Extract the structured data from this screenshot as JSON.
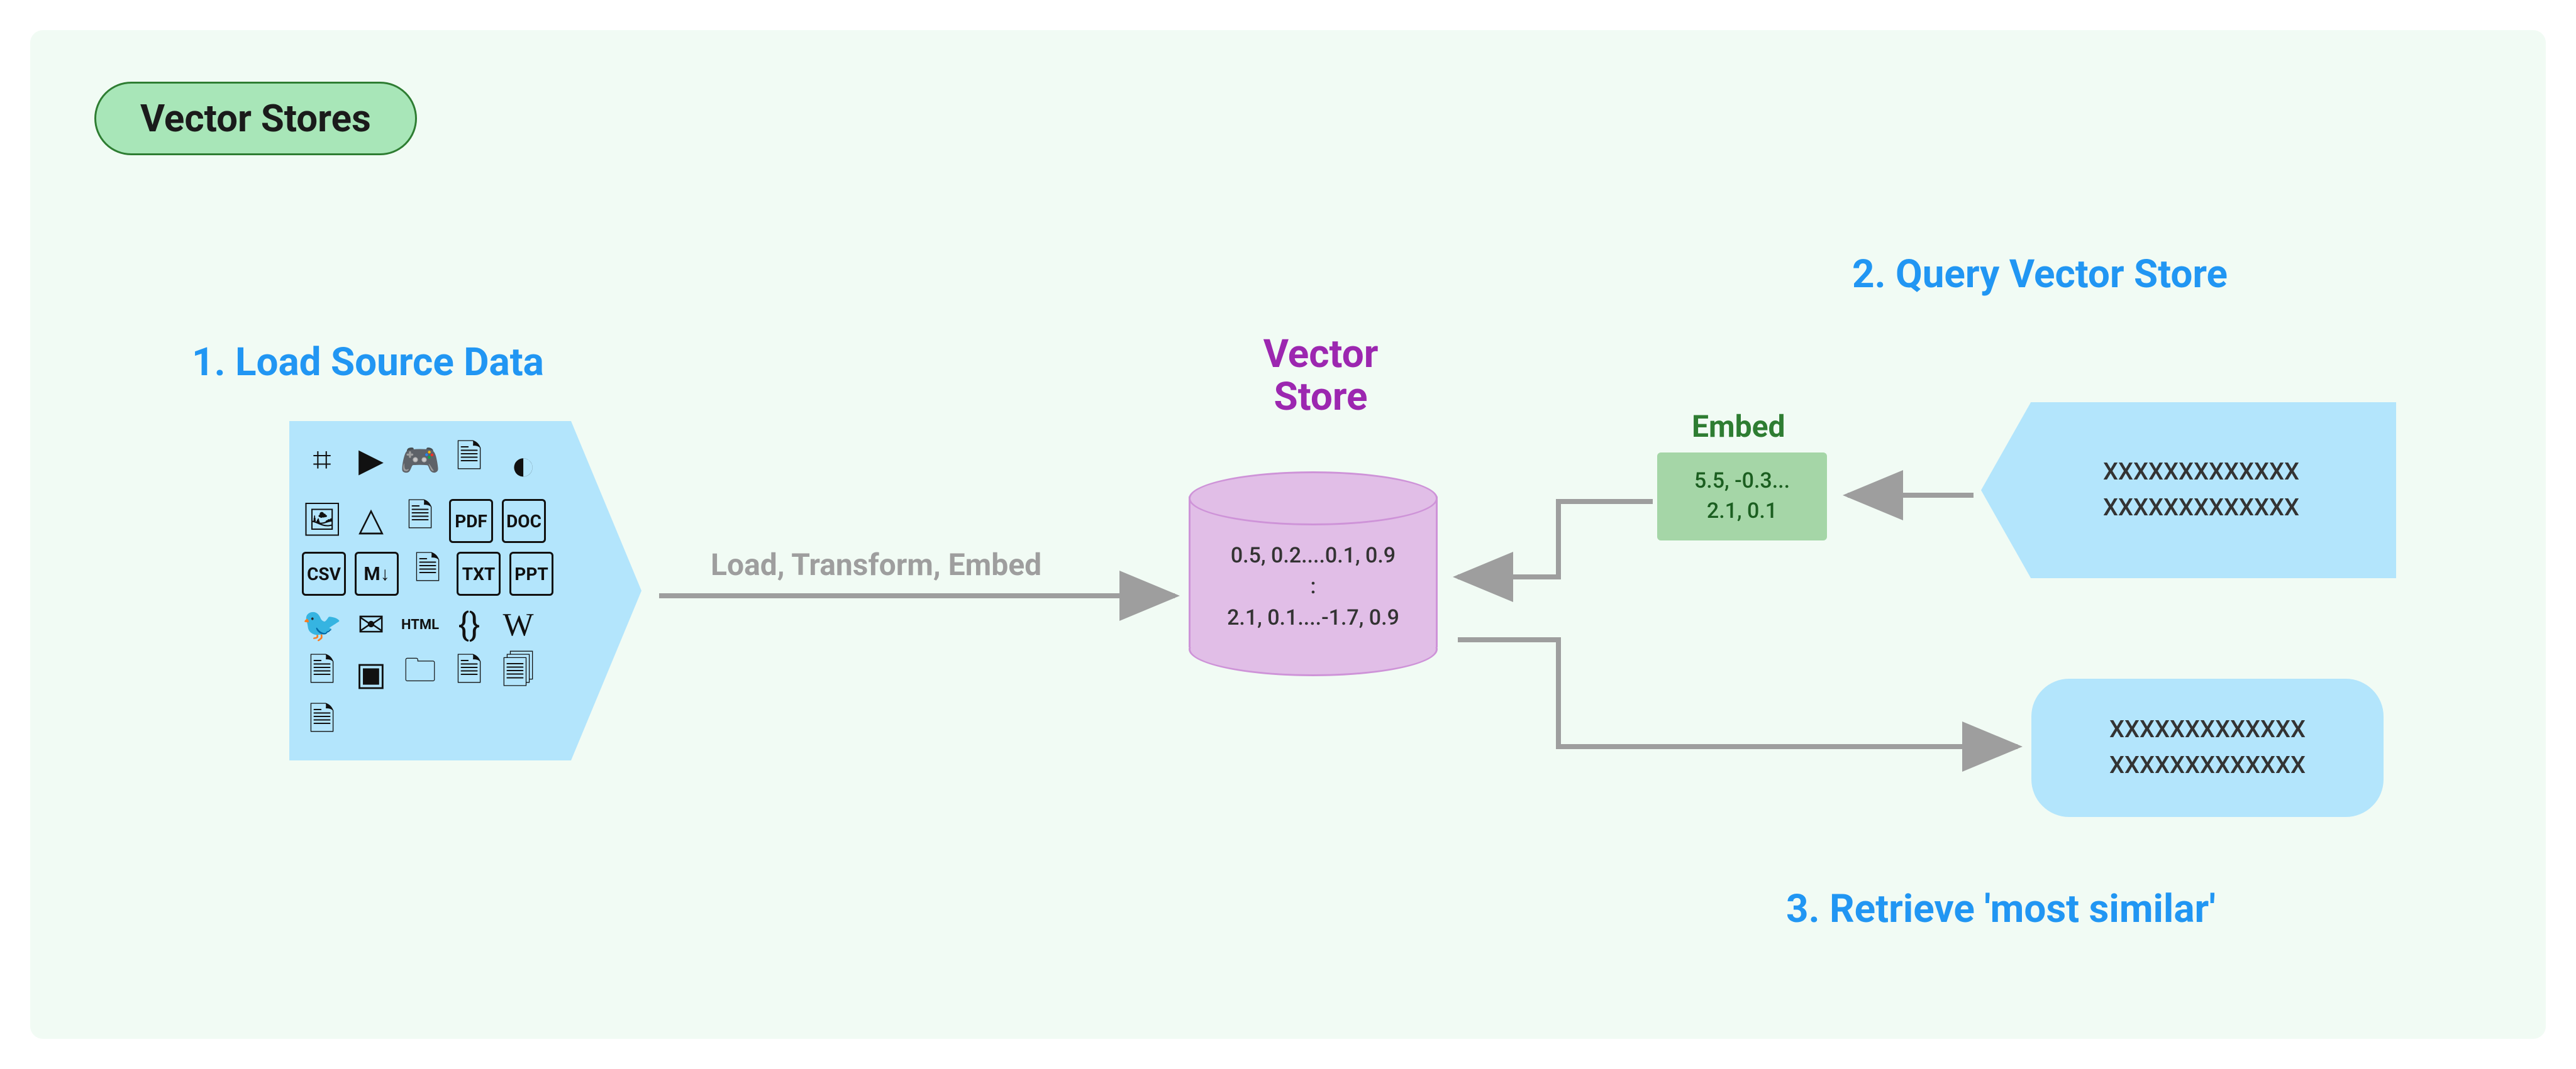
{
  "title": "Vector Stores",
  "steps": {
    "load": "1.  Load Source Data",
    "query": "2.  Query Vector Store",
    "retrieve": "3.  Retrieve 'most similar'"
  },
  "vector_store_label": "Vector\nStore",
  "arrow_label": "Load, Transform, Embed",
  "embed_label": "Embed",
  "cylinder": {
    "row1": "0.5, 0.2....0.1, 0.9",
    "row2": ":",
    "row3": "2.1, 0.1....-1.7, 0.9"
  },
  "embed_box": {
    "line1": "5.5, -0.3...",
    "line2": "2.1, 0.1"
  },
  "query_box": {
    "line1": "XXXXXXXXXXXXX",
    "line2": "XXXXXXXXXXXXX"
  },
  "result_box": {
    "line1": "XXXXXXXXXXXXX",
    "line2": "XXXXXXXXXXXXX"
  },
  "source_icons": [
    "slack-icon",
    "youtube-icon",
    "discord-icon",
    "file-icon",
    "github-icon",
    "image-icon",
    "gdrive-icon",
    "file-icon",
    "pdf-icon",
    "doc-icon",
    "csv-icon",
    "markdown-icon",
    "file-icon",
    "txt-icon",
    "ppt-icon",
    "twitter-icon",
    "mail-icon",
    "html-icon",
    "code-icon",
    "wikipedia-icon",
    "file-icon",
    "css-icon",
    "folder-icon",
    "file-icon",
    "file-icon",
    "file-icon"
  ],
  "colors": {
    "panel_bg": "#f1fbf4",
    "pill_bg": "#a8e6b8",
    "pill_border": "#2e7d32",
    "step_text": "#2196f3",
    "vs_text": "#9c27b0",
    "embed_text": "#2e7d32",
    "arrow": "#9e9e9e",
    "source_bg": "#b3e5fc",
    "cyl_bg": "#e1bee7",
    "embed_bg": "#a5d6a7"
  }
}
